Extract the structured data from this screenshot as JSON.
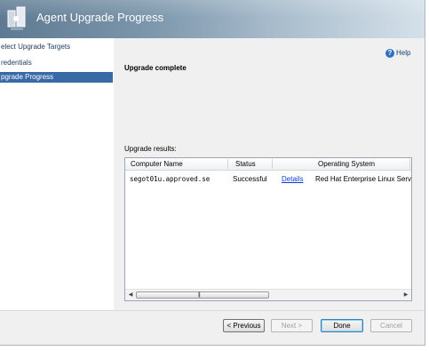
{
  "window": {
    "title": "Agent Upgrade Progress"
  },
  "sidebar": {
    "items": [
      {
        "label": "elect Upgrade Targets"
      },
      {
        "label": "redentials"
      },
      {
        "label": "pgrade Progress"
      }
    ]
  },
  "main": {
    "help_label": "Help",
    "heading": "Upgrade complete",
    "results_label": "Upgrade results:"
  },
  "results_table": {
    "columns": [
      "Computer Name",
      "Status",
      "Operating System"
    ],
    "rows": [
      {
        "computer": "segot01u.approved.se",
        "status": "Successful",
        "details": "Details",
        "os": "Red Hat Enterprise Linux Server r"
      }
    ]
  },
  "buttons": {
    "previous": "< Previous",
    "next": "Next >",
    "done": "Done",
    "cancel": "Cancel"
  }
}
